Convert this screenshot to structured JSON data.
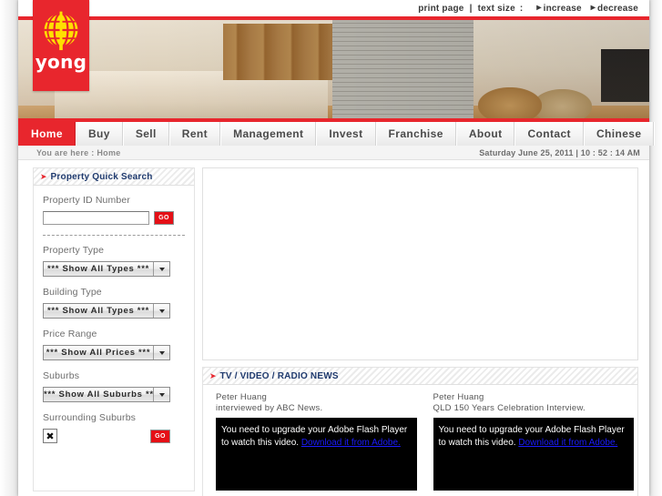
{
  "utility": {
    "print_page": "print page",
    "separator": "|",
    "text_size_label": "text size",
    "colon": ":",
    "increase": "increase",
    "decrease": "decrease"
  },
  "brand": {
    "name": "yong",
    "logo_color": "#e8262d",
    "globe_color": "#ffe000"
  },
  "nav": {
    "items": [
      {
        "label": "Home",
        "active": true
      },
      {
        "label": "Buy",
        "active": false
      },
      {
        "label": "Sell",
        "active": false
      },
      {
        "label": "Rent",
        "active": false
      },
      {
        "label": "Management",
        "active": false
      },
      {
        "label": "Invest",
        "active": false
      },
      {
        "label": "Franchise",
        "active": false
      },
      {
        "label": "About",
        "active": false
      },
      {
        "label": "Contact",
        "active": false
      },
      {
        "label": "Chinese",
        "active": false
      }
    ]
  },
  "crumb": {
    "text": "You are here : Home",
    "date": "Saturday June 25, 2011 | 10 : 52 : 14 AM"
  },
  "sidebar": {
    "panel_title": "Property Quick Search",
    "panel_marker": "➤",
    "id_label": "Property ID Number",
    "id_value": "",
    "id_placeholder": "",
    "go_label": "GO",
    "property_type_label": "Property Type",
    "property_type_value": "*** Show All Types ***",
    "building_type_label": "Building Type",
    "building_type_value": "*** Show All Types ***",
    "price_range_label": "Price Range",
    "price_range_value": "*** Show All Prices ***",
    "suburbs_label": "Suburbs",
    "suburbs_value": "*** Show All Suburbs ***",
    "surrounding_label": "Surrounding Suburbs",
    "surrounding_icon": "✖",
    "surrounding_go_label": "GO"
  },
  "news": {
    "panel_title": "TV / VIDEO / RADIO NEWS",
    "panel_marker": "➤",
    "videos": [
      {
        "person": "Peter Huang",
        "caption": "interviewed by ABC News.",
        "message": "You need to upgrade your Adobe Flash Player to watch this video.",
        "link": "Download it from Adobe."
      },
      {
        "person": "Peter Huang",
        "caption": "QLD 150 Years Celebration Interview.",
        "message": "You need to upgrade your Adobe Flash Player to watch this video.",
        "link": "Download it from Adobe."
      }
    ]
  }
}
